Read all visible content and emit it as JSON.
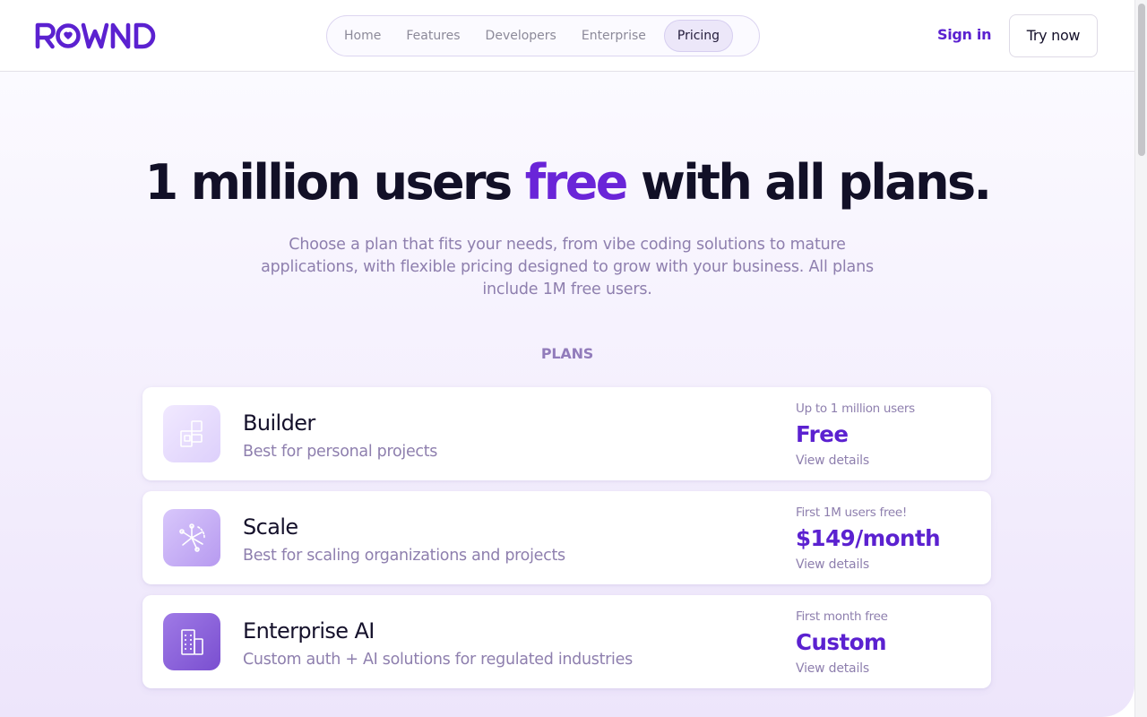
{
  "brand": {
    "logo_text": "ROWND",
    "color": "#5b21d0"
  },
  "nav": {
    "items": [
      {
        "label": "Home",
        "active": false
      },
      {
        "label": "Features",
        "active": false
      },
      {
        "label": "Developers",
        "active": false
      },
      {
        "label": "Enterprise",
        "active": false
      },
      {
        "label": "Pricing",
        "active": true
      }
    ]
  },
  "header": {
    "signin_label": "Sign in",
    "trynow_label": "Try now"
  },
  "hero": {
    "title_pre": "1 million users ",
    "title_accent": "free",
    "title_post": " with all plans.",
    "subtitle": "Choose a plan that fits your needs, from vibe coding solutions to mature applications, with flexible pricing designed to grow with your business. All plans include 1M free users."
  },
  "plans_label": "PLANS",
  "plans": [
    {
      "name": "Builder",
      "description": "Best for personal projects",
      "note": "Up to 1 million users",
      "price": "Free",
      "details_label": "View details",
      "icon": "building-blocks-icon"
    },
    {
      "name": "Scale",
      "description": "Best for scaling organizations and projects",
      "note": "First 1M users free!",
      "price": "$149/month",
      "details_label": "View details",
      "icon": "network-spark-icon"
    },
    {
      "name": "Enterprise AI",
      "description": "Custom auth + AI solutions for regulated industries",
      "note": "First month free",
      "price": "Custom",
      "details_label": "View details",
      "icon": "office-building-icon"
    }
  ],
  "colors": {
    "accent": "#6a25d8",
    "muted": "#8e7fae",
    "title": "#121027"
  }
}
